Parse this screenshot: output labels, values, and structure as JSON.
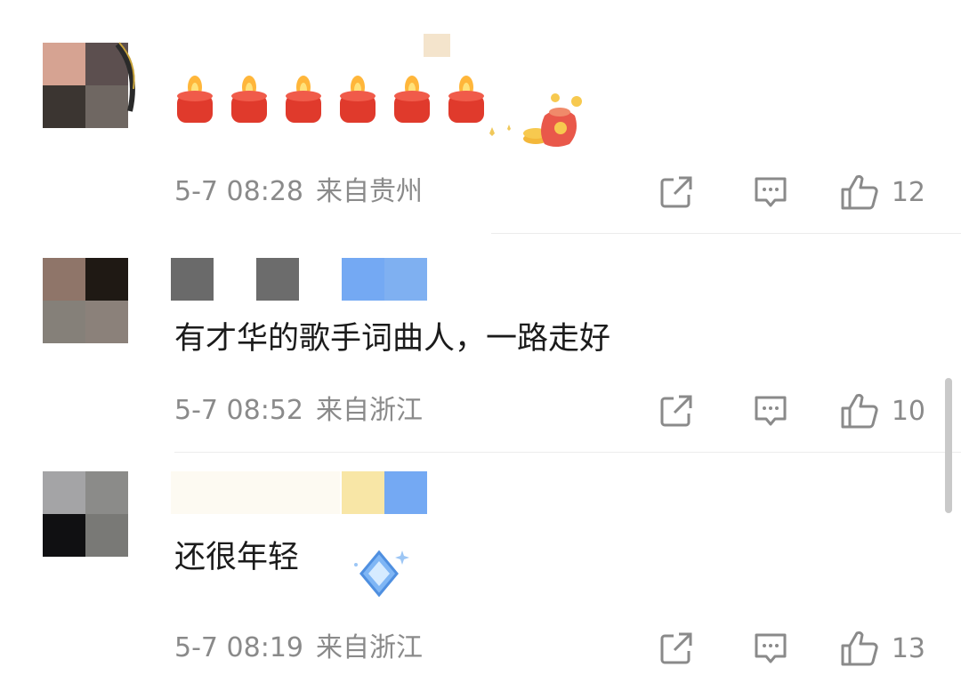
{
  "comments": [
    {
      "text": "",
      "time": "5-7 08:28",
      "location": "来自贵州",
      "likes": "12",
      "sticker": "candle-emoji",
      "sticker_count": 6
    },
    {
      "text": "有才华的歌手词曲人，一路走好",
      "time": "5-7 08:52",
      "location": "来自浙江",
      "likes": "10"
    },
    {
      "text": "还很年轻",
      "time": "5-7 08:19",
      "location": "来自浙江",
      "likes": "13"
    }
  ],
  "icons": {
    "share": "share-icon",
    "reply": "comment-icon",
    "like": "thumbs-up-icon"
  },
  "colors": {
    "meta_text": "#8a8a8a",
    "divider": "#ececec",
    "mosaic_blue": "#74a9f3",
    "mosaic_yellow": "#f8e6a6"
  }
}
